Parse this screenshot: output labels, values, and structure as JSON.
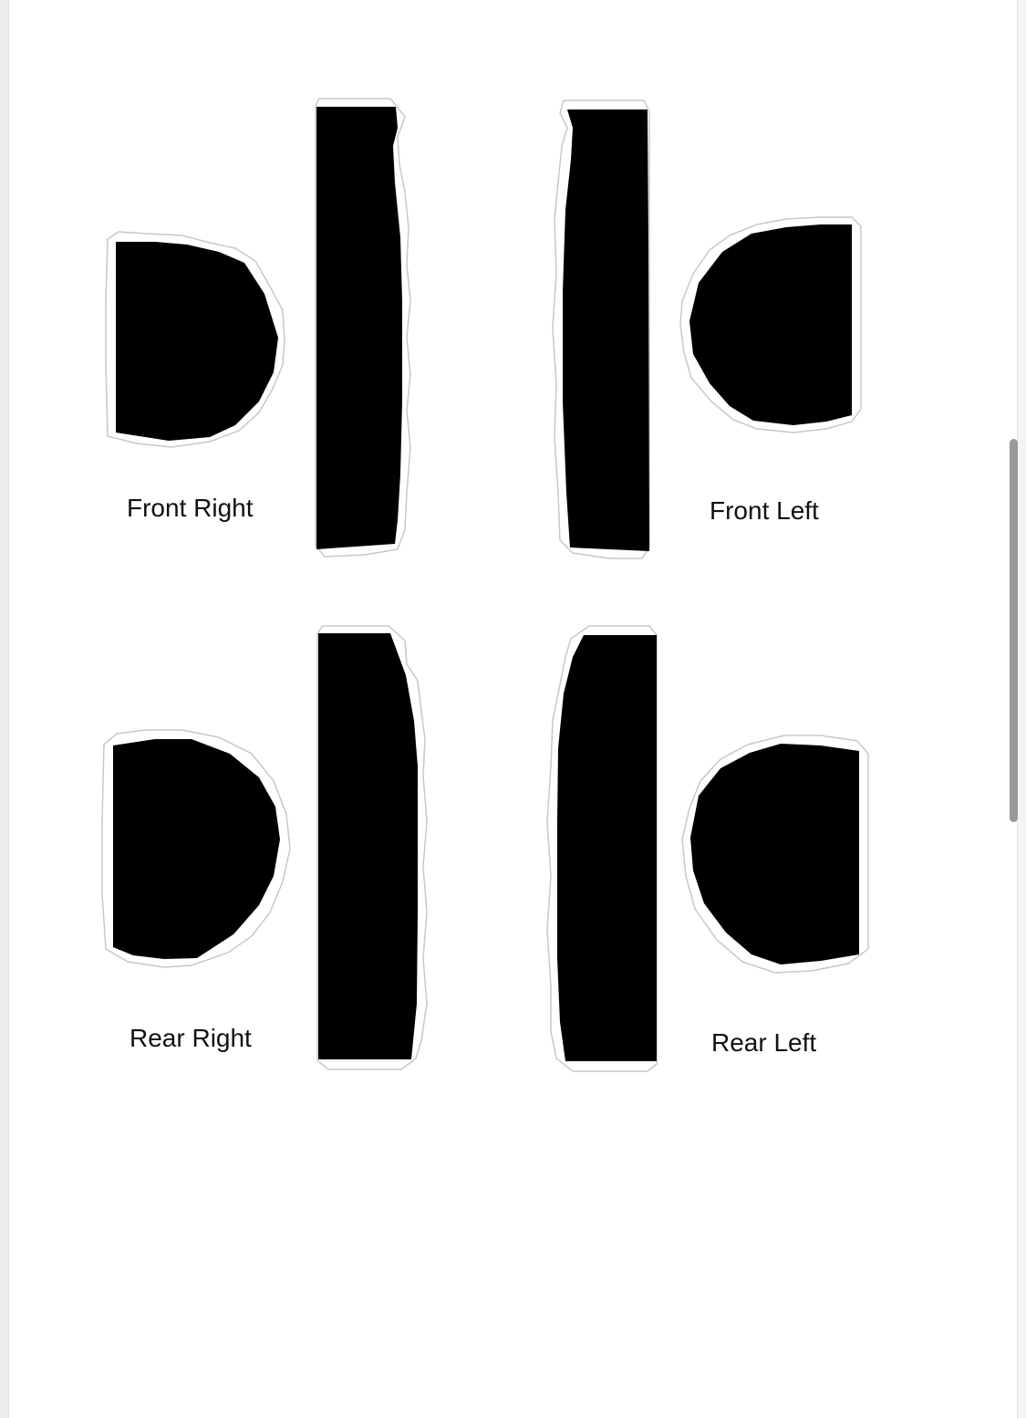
{
  "document": {
    "labels": {
      "front_right": "Front Right",
      "front_left": "Front Left",
      "rear_right": "Rear Right",
      "rear_left": "Rear Left"
    }
  },
  "colors": {
    "piece_fill": "#000000",
    "cut_outline": "#c8c8c8",
    "page_background": "#ffffff"
  }
}
